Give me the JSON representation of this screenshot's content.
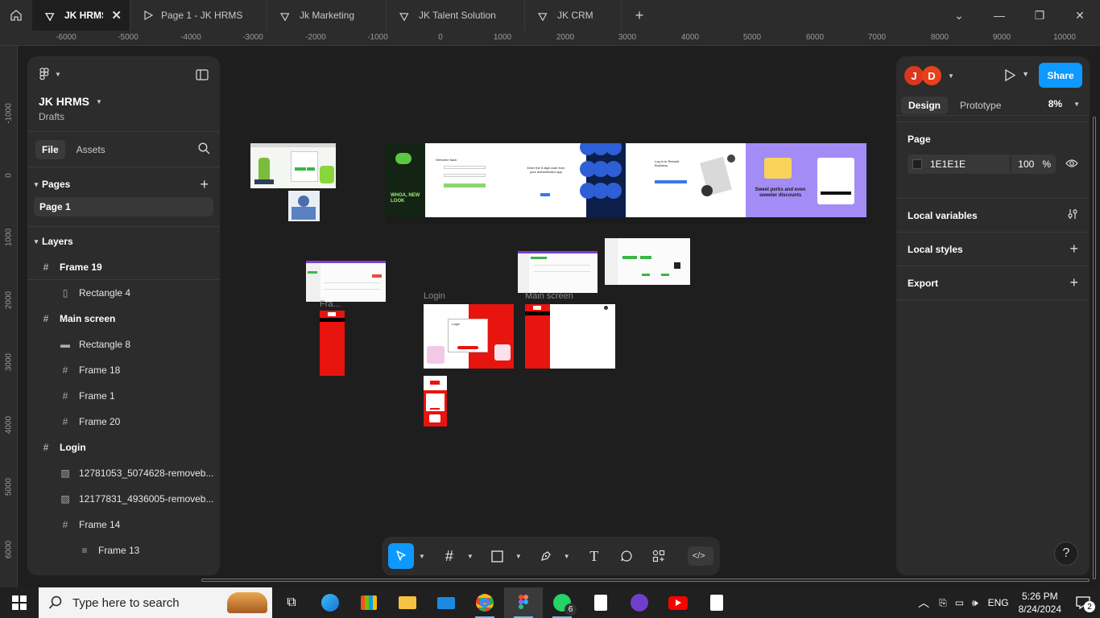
{
  "tabs": [
    {
      "label": "JK HRMS",
      "active": true
    },
    {
      "label": "Page 1 - JK HRMS"
    },
    {
      "label": "Jk Marketing"
    },
    {
      "label": "JK Talent Solution"
    },
    {
      "label": "JK CRM"
    }
  ],
  "ruler": {
    "x_ticks": [
      "-6000",
      "-5000",
      "-4000",
      "-3000",
      "-2000",
      "-1000",
      "0",
      "1000",
      "2000",
      "3000",
      "4000",
      "5000",
      "6000",
      "7000",
      "8000",
      "9000",
      "10000"
    ],
    "y_ticks": [
      "-1000",
      "0",
      "1000",
      "2000",
      "3000",
      "4000",
      "5000",
      "6000"
    ]
  },
  "left_panel": {
    "project_title": "JK HRMS",
    "project_sub": "Drafts",
    "tab_file": "File",
    "tab_assets": "Assets",
    "pages_title": "Pages",
    "current_page": "Page 1",
    "layers_title": "Layers",
    "layers": [
      {
        "label": "Frame 19",
        "icon": "frame-icon"
      },
      {
        "label": "Rectangle 4",
        "icon": "rectangle-icon"
      },
      {
        "label": "Main screen",
        "icon": "frame-icon"
      },
      {
        "label": "Rectangle 8",
        "icon": "rectangle-icon"
      },
      {
        "label": "Frame 18",
        "icon": "frame-icon"
      },
      {
        "label": "Frame 1",
        "icon": "frame-icon"
      },
      {
        "label": "Frame 20",
        "icon": "frame-icon"
      },
      {
        "label": "Login",
        "icon": "frame-icon"
      },
      {
        "label": "12781053_5074628-removeb...",
        "icon": "image-icon"
      },
      {
        "label": "12177831_4936005-removeb...",
        "icon": "image-icon"
      },
      {
        "label": "Frame 14",
        "icon": "frame-icon"
      },
      {
        "label": "Frame 13",
        "icon": "autolayout-icon"
      }
    ]
  },
  "right_panel": {
    "avatars": [
      {
        "letter": "J",
        "color": "#d9381e"
      },
      {
        "letter": "D",
        "color": "#e8401c"
      }
    ],
    "share_label": "Share",
    "tab_design": "Design",
    "tab_prototype": "Prototype",
    "zoom": "8%",
    "page_title": "Page",
    "bg_hex": "1E1E1E",
    "bg_opacity": "100",
    "bg_opacity_unit": "%",
    "local_variables": "Local variables",
    "local_styles": "Local styles",
    "export": "Export",
    "help": "?"
  },
  "canvas": {
    "label_login": "Login",
    "label_main_screen": "Main screen",
    "label_frame": "Fra...",
    "thumb_headline": "WHOA, NEW LOOK",
    "thumb_welcome": "Welcome back",
    "thumb_digit": "Enter the 6 digit code from your authenticator app",
    "thumb_login_rebuild": "Log in to Rebuild Business",
    "thumb_perks": "Sweet perks and even sweeter discounts",
    "thumb_login": "Login"
  },
  "taskbar": {
    "search_placeholder": "Type here to search",
    "time": "5:26 PM",
    "date": "8/24/2024",
    "lang": "ENG",
    "whatsapp_badge": "6",
    "notif_count": "2"
  },
  "colors": {
    "accent": "#0d99ff",
    "canvas_bg": "#1e1e1e",
    "panel_bg": "#2c2c2c",
    "brand_red": "#e8140f"
  }
}
